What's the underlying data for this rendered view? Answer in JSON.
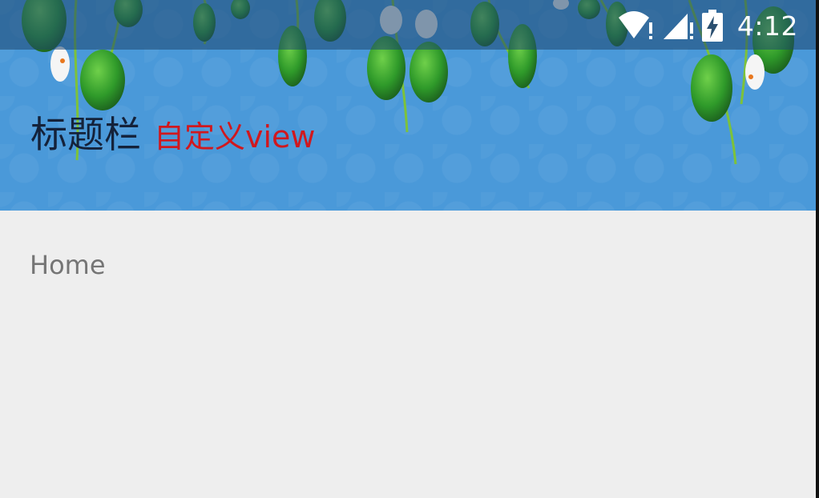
{
  "status_bar": {
    "time": "4:12",
    "icons": [
      "wifi-alert-icon",
      "signal-alert-icon",
      "battery-charging-icon"
    ]
  },
  "toolbar": {
    "title": "标题栏",
    "subtitle": "自定义view",
    "background_color": "#4a99d9",
    "title_color": "#14223a",
    "subtitle_color": "#d0181e",
    "decoration": "hanging-vines-illustration"
  },
  "content": {
    "label": "Home",
    "background_color": "#eeeeee"
  }
}
